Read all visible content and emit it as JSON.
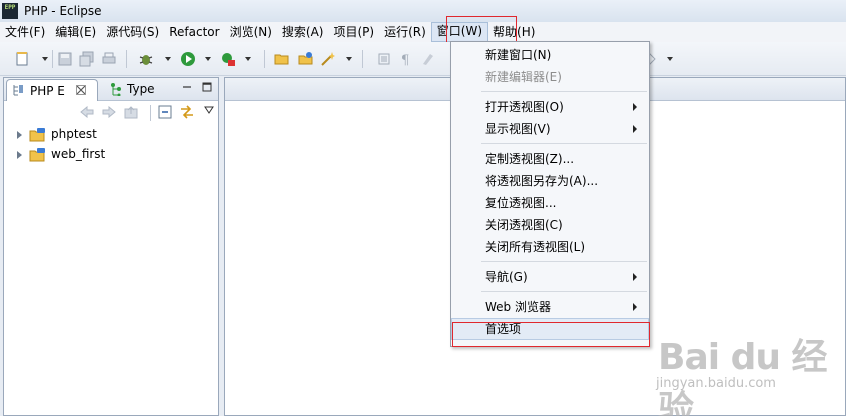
{
  "window": {
    "title": "PHP - Eclipse",
    "app_icon_text": "EPP"
  },
  "menubar": {
    "items": [
      "文件(F)",
      "编辑(E)",
      "源代码(S)",
      "Refactor",
      "浏览(N)",
      "搜索(A)",
      "项目(P)",
      "运行(R)",
      "窗口(W)",
      "帮助(H)"
    ],
    "active_index": 8
  },
  "left_view": {
    "tabs": [
      {
        "label": "PHP E",
        "active": true,
        "closable": true
      },
      {
        "label": "Type",
        "active": false,
        "closable": false
      }
    ],
    "tree": [
      {
        "label": "phptest",
        "icon": "php-project-icon"
      },
      {
        "label": "web_first",
        "icon": "php-project-icon"
      }
    ]
  },
  "dropdown": {
    "items": [
      {
        "label": "新建窗口(N)",
        "disabled": false,
        "submenu": false
      },
      {
        "label": "新建编辑器(E)",
        "disabled": true,
        "submenu": false
      },
      {
        "separator": true
      },
      {
        "label": "打开透视图(O)",
        "disabled": false,
        "submenu": true
      },
      {
        "label": "显示视图(V)",
        "disabled": false,
        "submenu": true
      },
      {
        "separator": true
      },
      {
        "label": "定制透视图(Z)...",
        "disabled": false,
        "submenu": false
      },
      {
        "label": "将透视图另存为(A)...",
        "disabled": false,
        "submenu": false
      },
      {
        "label": "复位透视图...",
        "disabled": false,
        "submenu": false
      },
      {
        "label": "关闭透视图(C)",
        "disabled": false,
        "submenu": false
      },
      {
        "label": "关闭所有透视图(L)",
        "disabled": false,
        "submenu": false
      },
      {
        "separator": true
      },
      {
        "label": "导航(G)",
        "disabled": false,
        "submenu": true
      },
      {
        "separator": true
      },
      {
        "label": "Web 浏览器",
        "disabled": false,
        "submenu": true
      },
      {
        "label": "首选项",
        "disabled": false,
        "submenu": false,
        "hover": true
      }
    ]
  },
  "colors": {
    "highlight_box": "#e0282e",
    "menu_hover": "#e3ebf6"
  },
  "watermark": {
    "brand": "Bai du 经验",
    "url": "jingyan.baidu.com"
  }
}
